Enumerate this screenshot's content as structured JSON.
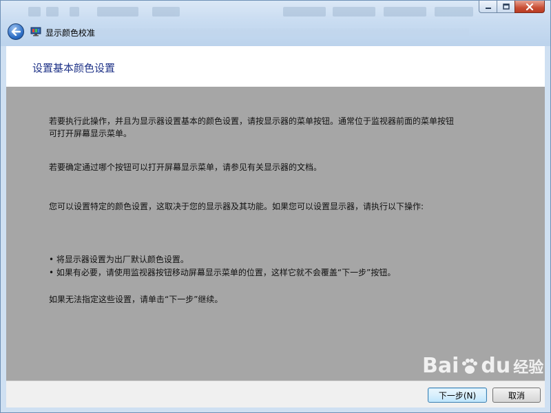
{
  "window": {
    "title": "显示颜色校准"
  },
  "header": {
    "heading": "设置基本颜色设置"
  },
  "content": {
    "paragraph1_line1": "若要执行此操作，并且为显示器设置基本的颜色设置，请按显示器的菜单按钮。通常位于监视器前面的菜单按钮",
    "paragraph1_line2": "可打开屏幕显示菜单。",
    "paragraph2": "若要确定通过哪个按钮可以打开屏幕显示菜单，请参见有关显示器的文档。",
    "paragraph3": "您可以设置特定的颜色设置，这取决于您的显示器及其功能。如果您可以设置显示器，请执行以下操作:",
    "bullets": [
      "将显示器设置为出厂默认颜色设置。",
      "如果有必要，请使用监视器按钮移动屏幕显示菜单的位置，这样它就不会覆盖“下一步”按钮。"
    ],
    "paragraph4": "如果无法指定这些设置，请单击“下一步”继续。"
  },
  "footer": {
    "next_label": "下一步(N)",
    "cancel_label": "取消"
  },
  "watermark": {
    "brand": "Bai",
    "brand_suffix": "du",
    "sub": "经验"
  },
  "colors": {
    "heading": "#1e3287",
    "content_bg": "#a6a6a6",
    "header_bg": "#ffffff",
    "footer_bg": "#f0f0f0"
  },
  "icons": {
    "back": "back-arrow-icon",
    "app": "monitor-icon",
    "minimize": "minimize-icon",
    "maximize": "maximize-icon",
    "close": "close-icon"
  }
}
